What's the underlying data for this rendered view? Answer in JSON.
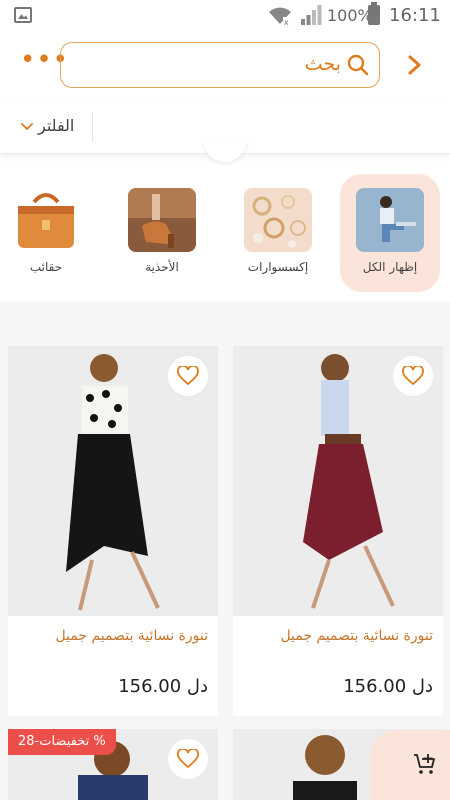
{
  "status_bar": {
    "battery": "100%",
    "time": "16:11"
  },
  "header": {
    "search_placeholder": "بحث",
    "more_icon": "more-dots-icon",
    "back_icon": "chevron-right-icon"
  },
  "filter": {
    "label": "الفلتر"
  },
  "categories": [
    {
      "label": "إظهار الكل",
      "active": true
    },
    {
      "label": "إكسسوارات",
      "active": false
    },
    {
      "label": "الأحذية",
      "active": false
    },
    {
      "label": "حقائب",
      "active": false
    }
  ],
  "products": [
    {
      "name": "تنورة نسائية بتصميم جميل",
      "price": "دل 156.00"
    },
    {
      "name": "تنورة نسائية بتصميم جميل",
      "price": "دل 156.00"
    }
  ],
  "sale_badge": "تخفيضات-28 %",
  "colors": {
    "accent": "#e07b1c",
    "active_bg": "#fbe5da",
    "sale": "#ec4f49"
  }
}
